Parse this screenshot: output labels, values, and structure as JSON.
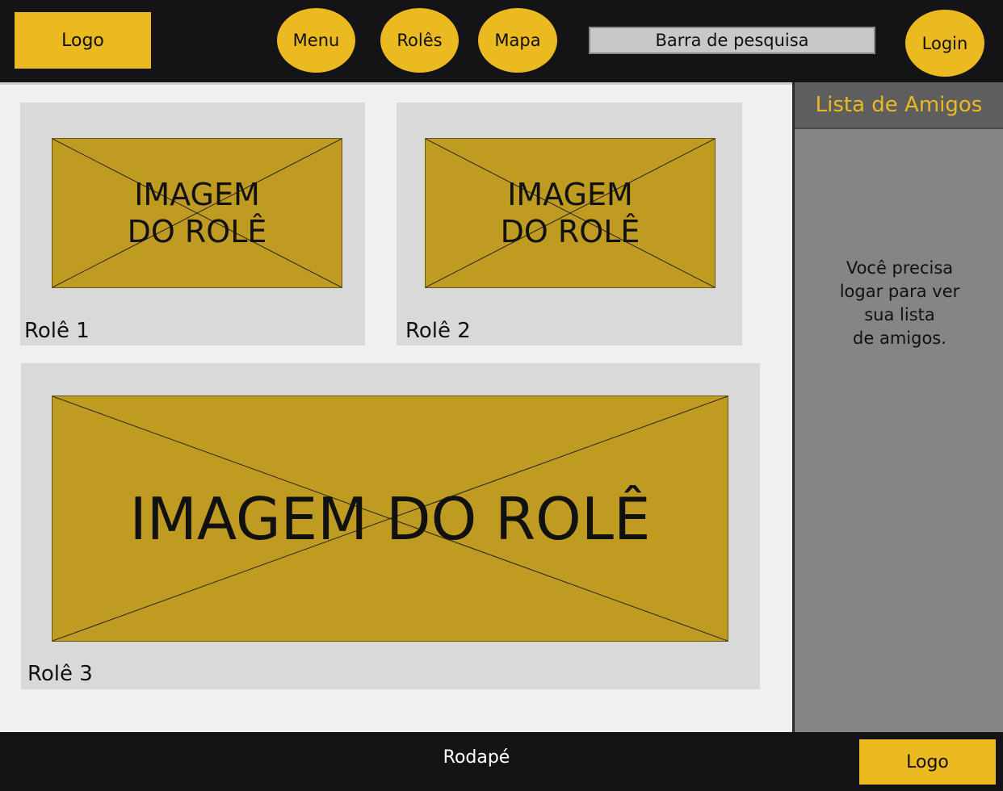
{
  "header": {
    "logo": "Logo",
    "nav": [
      {
        "label": "Menu"
      },
      {
        "label": "Rolês"
      },
      {
        "label": "Mapa"
      }
    ],
    "search_placeholder": "Barra de pesquisa",
    "login": "Login"
  },
  "cards": [
    {
      "image_line1": "IMAGEM",
      "image_line2": "DO ROLÊ",
      "title": "Rolê 1"
    },
    {
      "image_line1": "IMAGEM",
      "image_line2": "DO ROLÊ",
      "title": "Rolê 2"
    },
    {
      "image_label": "IMAGEM DO ROLÊ",
      "title": "Rolê 3"
    }
  ],
  "sidebar": {
    "title": "Lista de Amigos",
    "message": "Você precisa\nlogar para ver\nsua lista\nde amigos."
  },
  "footer": {
    "text": "Rodapé",
    "logo": "Logo"
  },
  "colors": {
    "accent": "#ebb920",
    "image_placeholder": "#bf9b21",
    "header_bg": "#141416",
    "sidebar_bg": "#858585"
  }
}
